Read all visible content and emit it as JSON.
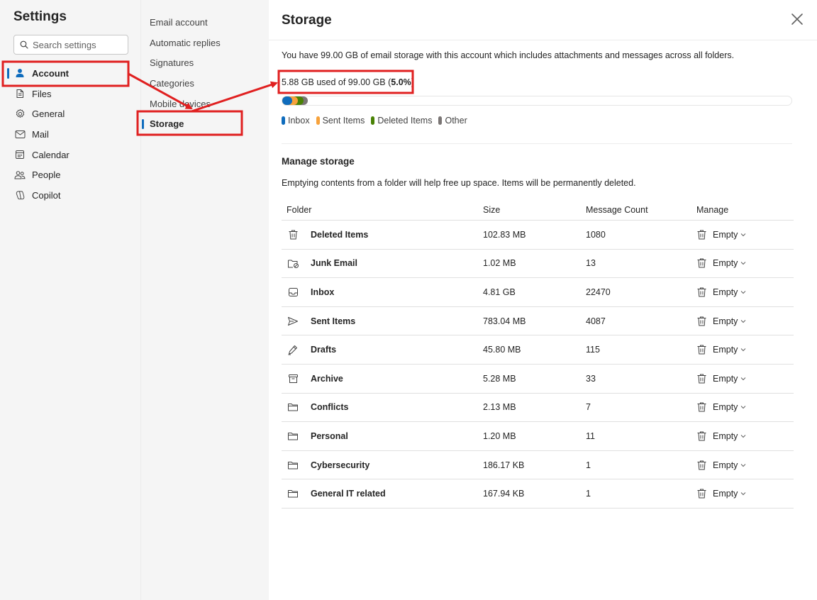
{
  "nav": {
    "title": "Settings",
    "search_placeholder": "Search settings",
    "items": [
      {
        "label": "Account",
        "icon": "person-icon",
        "selected": true
      },
      {
        "label": "Files",
        "icon": "file-icon"
      },
      {
        "label": "General",
        "icon": "gear-icon"
      },
      {
        "label": "Mail",
        "icon": "mail-icon"
      },
      {
        "label": "Calendar",
        "icon": "calendar-icon"
      },
      {
        "label": "People",
        "icon": "people-icon"
      },
      {
        "label": "Copilot",
        "icon": "copilot-icon"
      }
    ]
  },
  "subnav": {
    "items": [
      {
        "label": "Email account"
      },
      {
        "label": "Automatic replies"
      },
      {
        "label": "Signatures"
      },
      {
        "label": "Categories"
      },
      {
        "label": "Mobile devices"
      },
      {
        "label": "Storage",
        "selected": true
      }
    ]
  },
  "main": {
    "title": "Storage",
    "intro": "You have 99.00 GB of email storage with this account which includes attachments and messages across all folders.",
    "used_prefix": "5.88 GB used of 99.00 GB (",
    "used_percent": "5.0%",
    "used_suffix": ")",
    "usage_fraction": 0.05,
    "legend": [
      {
        "label": "Inbox",
        "color": "#0f6cbd"
      },
      {
        "label": "Sent Items",
        "color": "#f7a23b"
      },
      {
        "label": "Deleted Items",
        "color": "#498205"
      },
      {
        "label": "Other",
        "color": "#7a7574"
      }
    ],
    "manage_title": "Manage storage",
    "manage_desc": "Emptying contents from a folder will help free up space. Items will be permanently deleted.",
    "columns": {
      "folder": "Folder",
      "size": "Size",
      "count": "Message Count",
      "manage": "Manage"
    },
    "empty_label": "Empty",
    "folders": [
      {
        "name": "Deleted Items",
        "size": "102.83 MB",
        "count": "1080",
        "icon": "trash-icon"
      },
      {
        "name": "Junk Email",
        "size": "1.02 MB",
        "count": "13",
        "icon": "junk-folder-icon"
      },
      {
        "name": "Inbox",
        "size": "4.81 GB",
        "count": "22470",
        "icon": "inbox-icon"
      },
      {
        "name": "Sent Items",
        "size": "783.04 MB",
        "count": "4087",
        "icon": "send-icon"
      },
      {
        "name": "Drafts",
        "size": "45.80 MB",
        "count": "115",
        "icon": "pencil-icon"
      },
      {
        "name": "Archive",
        "size": "5.28 MB",
        "count": "33",
        "icon": "archive-icon"
      },
      {
        "name": "Conflicts",
        "size": "2.13 MB",
        "count": "7",
        "icon": "folder-icon"
      },
      {
        "name": "Personal",
        "size": "1.20 MB",
        "count": "11",
        "icon": "folder-icon"
      },
      {
        "name": "Cybersecurity",
        "size": "186.17 KB",
        "count": "1",
        "icon": "folder-icon"
      },
      {
        "name": "General IT related",
        "size": "167.94 KB",
        "count": "1",
        "icon": "folder-icon"
      }
    ]
  },
  "annotation_color": "#e02020"
}
